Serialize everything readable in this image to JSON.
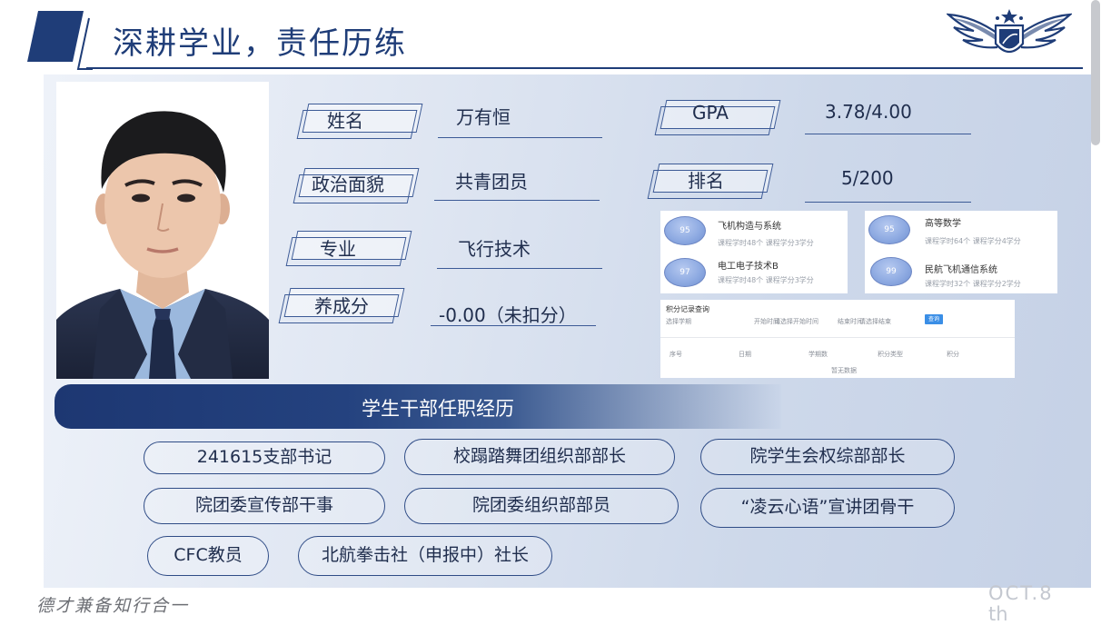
{
  "header": {
    "title": "深耕学业，责任历练"
  },
  "profile": {
    "rows": [
      {
        "label": "姓名",
        "value": "万有恒"
      },
      {
        "label": "政治面貌",
        "value": "共青团员"
      },
      {
        "label": "专业",
        "value": "飞行技术"
      },
      {
        "label": "养成分",
        "value": "-0.00（未扣分）"
      }
    ],
    "gpa": {
      "label": "GPA",
      "value": "3.78/4.00"
    },
    "rank": {
      "label": "排名",
      "value": "5/200"
    }
  },
  "courses": [
    {
      "score": "95",
      "name": "飞机构造与系统",
      "detail": "课程学时48个 课程学分3学分"
    },
    {
      "score": "97",
      "name": "电工电子技术B",
      "detail": "课程学时48个 课程学分3学分"
    },
    {
      "score": "95",
      "name": "高等数学",
      "detail": "课程学时64个 课程学分4学分"
    },
    {
      "score": "99",
      "name": "民航飞机通信系统",
      "detail": "课程学时32个 课程学分2学分"
    }
  ],
  "query_panel": {
    "title": "积分记录查询",
    "filters": [
      "选择学期",
      "开始时间",
      "请选择开始时间",
      "结束时间",
      "请选择结束",
      "查询"
    ],
    "columns": [
      "序号",
      "日期",
      "学期数",
      "积分类型",
      "积分"
    ],
    "empty_text": "暂无数据"
  },
  "section": {
    "title": "学生干部任职经历"
  },
  "positions": [
    "241615支部书记",
    "校蹋踏舞团组织部部长",
    "院学生会权综部部长",
    "院团委宣传部干事",
    "院团委组织部部员",
    "“凌云心语”宣讲团骨干",
    "CFC教员",
    "北航拳击社（申报中）社长"
  ],
  "footer": {
    "motto": "德才兼备知行合一",
    "date_line1": "OCT.8",
    "date_line2": "th"
  },
  "colors": {
    "primary": "#1f3d78",
    "accent": "#3a8ee6",
    "text": "#1f2d4d"
  }
}
